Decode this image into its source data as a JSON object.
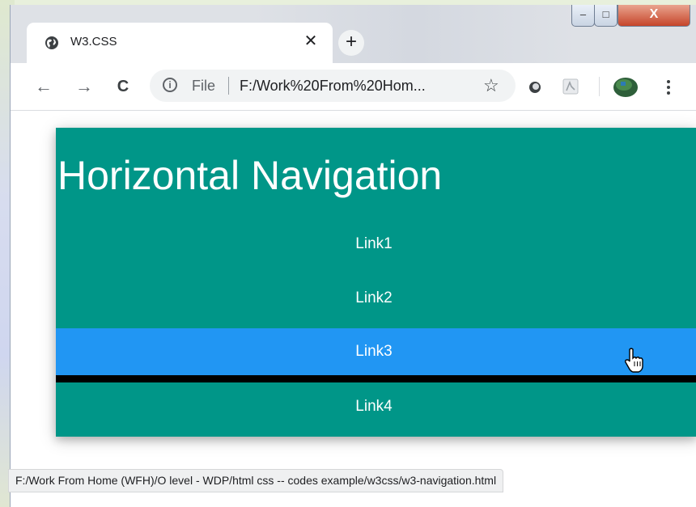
{
  "browser": {
    "tab": {
      "title": "W3.CSS",
      "close_icon": "close-icon",
      "favicon": "globe-icon"
    },
    "new_tab_icon": "plus-icon",
    "window_controls": {
      "minimize": "–",
      "maximize": "□",
      "close": "X"
    },
    "toolbar": {
      "back_icon": "←",
      "forward_icon": "→",
      "reload_icon": "C",
      "omnibox": {
        "info_icon": "i",
        "scheme_label": "File",
        "url": "F:/Work%20From%20Hom...",
        "bookmark_icon": "☆"
      }
    },
    "status_url": "F:/Work From Home (WFH)/O level - WDP/html css -- codes example/w3css/w3-navigation.html"
  },
  "page": {
    "heading": "Horizontal Navigation",
    "links": [
      "Link1",
      "Link2",
      "Link3",
      "Link4"
    ],
    "hovered_link": "Link3"
  },
  "colors": {
    "teal": "#009688",
    "blue_hover": "#2196f3",
    "separator": "#000000"
  }
}
